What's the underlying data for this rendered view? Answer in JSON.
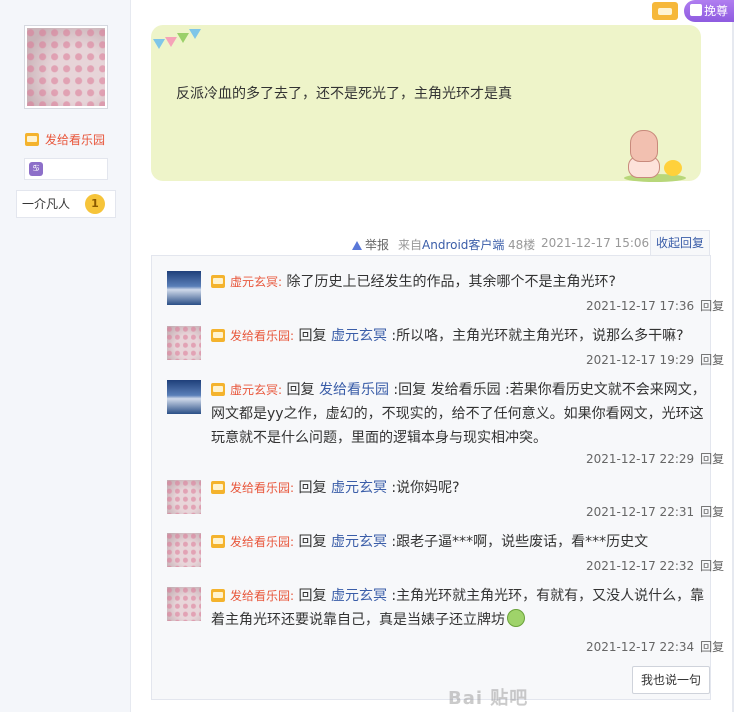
{
  "author": {
    "send_to": "发给看乐园",
    "rank_title": "一介凡人",
    "rank_level": "1",
    "zodiac_icon": "zodiac-icon"
  },
  "top_right": {
    "vip_label": "挽尊"
  },
  "post": {
    "content": "反派冷血的多了去了，还不是死光了，主角光环才是真",
    "report": "举报",
    "source_prefix": "来自",
    "source_link": "Android客户端",
    "floor": "48楼",
    "time": "2021-12-17 15:06",
    "collapse": "收起回复"
  },
  "replies": [
    {
      "user": "虚元玄冥",
      "colon": ":",
      "text": "除了历史上已经发生的作品，其余哪个不是主角光环?",
      "time": "2021-12-17 17:36",
      "reply": "回复"
    },
    {
      "user": "发给看乐园",
      "colon": ":",
      "reply_word": "回复",
      "target": "虚元玄冥",
      "text": ":所以咯，主角光环就主角光环，说那么多干嘛?",
      "time": "2021-12-17 19:29",
      "reply": "回复"
    },
    {
      "user": "虚元玄冥",
      "colon": ":",
      "reply_word": "回复",
      "target": "发给看乐园",
      "text": ":回复 发给看乐园 :若果你看历史文就不会来网文，网文都是yy之作，虚幻的，不现实的，给不了任何意义。如果你看网文，光环这玩意就不是什么问题，里面的逻辑本身与现实相冲突。",
      "time": "2021-12-17 22:29",
      "reply": "回复"
    },
    {
      "user": "发给看乐园",
      "colon": ":",
      "reply_word": "回复",
      "target": "虚元玄冥",
      "text": ":说你妈呢?",
      "time": "2021-12-17 22:31",
      "reply": "回复"
    },
    {
      "user": "发给看乐园",
      "colon": ":",
      "reply_word": "回复",
      "target": "虚元玄冥",
      "text": ":跟老子逼***啊，说些废话，看***历史文",
      "time": "2021-12-17 22:32",
      "reply": "回复"
    },
    {
      "user": "发给看乐园",
      "colon": ":",
      "reply_word": "回复",
      "target": "虚元玄冥",
      "text": ":主角光环就主角光环，有就有，又没人说什么，靠着主角光环还要说靠自己，真是当婊子还立牌坊",
      "time": "2021-12-17 22:34",
      "reply": "回复"
    }
  ],
  "say_button": "我也说一句",
  "watermark": "Bai 贴吧"
}
